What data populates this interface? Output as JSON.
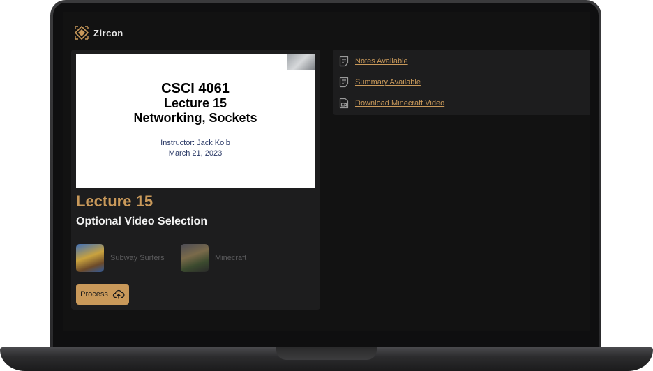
{
  "app": {
    "name": "Zircon",
    "accent_color": "#c9995a"
  },
  "slide": {
    "course": "CSCI 4061",
    "lecture": "Lecture 15",
    "topic": "Networking, Sockets",
    "instructor": "Instructor: Jack Kolb",
    "date": "March 21, 2023"
  },
  "lecture": {
    "title": "Lecture 15",
    "section_title": "Optional Video Selection",
    "video_options": [
      {
        "label": "Subway Surfers",
        "icon": "subway-surfers-thumbnail"
      },
      {
        "label": "Minecraft",
        "icon": "minecraft-thumbnail"
      }
    ],
    "process_label": "Process",
    "process_icon": "cloud-upload-icon"
  },
  "links": [
    {
      "label": "Notes Available",
      "icon": "document-icon"
    },
    {
      "label": "Summary Available",
      "icon": "document-icon"
    },
    {
      "label": "Download Minecraft Video",
      "icon": "video-file-icon"
    }
  ]
}
